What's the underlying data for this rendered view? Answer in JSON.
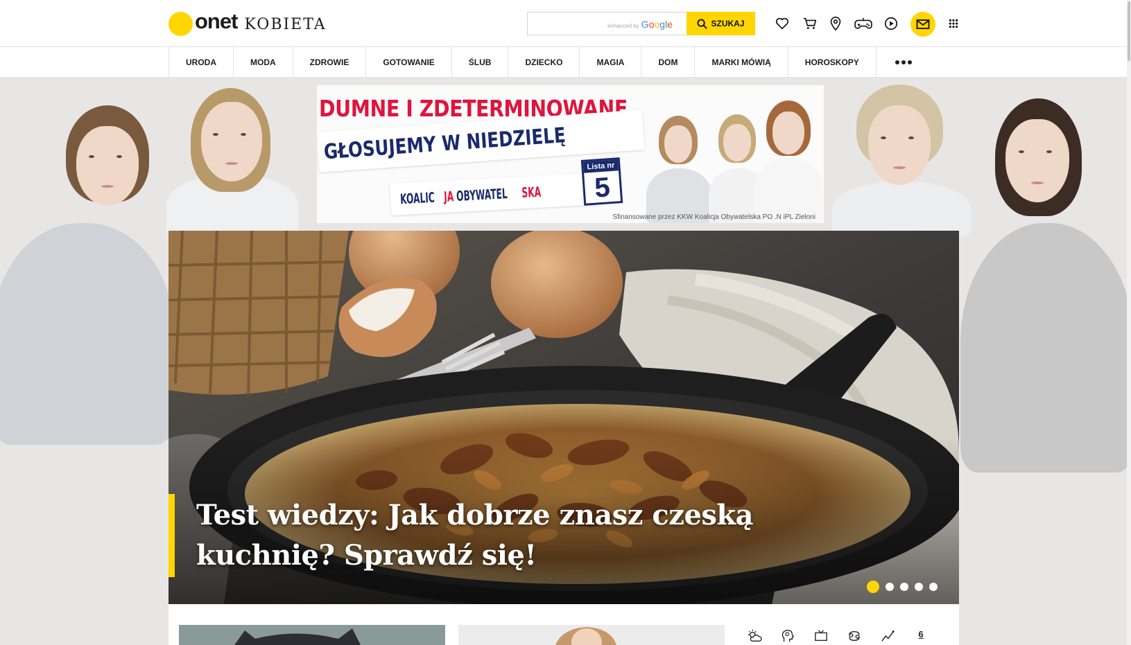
{
  "header": {
    "logo_brand": "onet",
    "logo_section": "KOBIETA",
    "search": {
      "placeholder": "",
      "enhanced_label": "enhanced by",
      "google_label": [
        "G",
        "o",
        "o",
        "g",
        "l",
        "e"
      ],
      "button_label": "SZUKAJ"
    },
    "icons": [
      "heart-icon",
      "cart-icon",
      "location-pin-icon",
      "gamepad-icon",
      "play-icon",
      "mail-icon",
      "apps-grid-icon"
    ],
    "accent_color": "#ffd602"
  },
  "nav": {
    "items": [
      "URODA",
      "MODA",
      "ZDROWIE",
      "GOTOWANIE",
      "ŚLUB",
      "DZIECKO",
      "MAGIA",
      "DOM",
      "MARKI MÓWIĄ",
      "HOROSKOPY"
    ]
  },
  "banner": {
    "headline": "DUMNE I ZDETERMINOWANE",
    "subline": "GŁOSUJEMY W NIEDZIELĘ",
    "party_part1": "KOALIC",
    "party_part2": "JA ",
    "party_part3": "OBYWATEL",
    "party_part4": "SKA",
    "list_label": "Lista nr",
    "list_number": "5",
    "disclaimer": "Sfinansowane przez KKW Koalicja Obywatelska PO .N iPL Zieloni",
    "colors": {
      "red": "#e0143c",
      "navy": "#1a2a6c"
    }
  },
  "hero": {
    "title": "Test wiedzy: Jak dobrze znasz czeską kuchnię? Sprawdź się!",
    "slides_total": 5,
    "active_slide": 1
  },
  "services": {
    "icons": [
      "weather-icon",
      "health-icon",
      "tv-icon",
      "zodiac-icon",
      "trend-icon"
    ],
    "number": "6"
  }
}
